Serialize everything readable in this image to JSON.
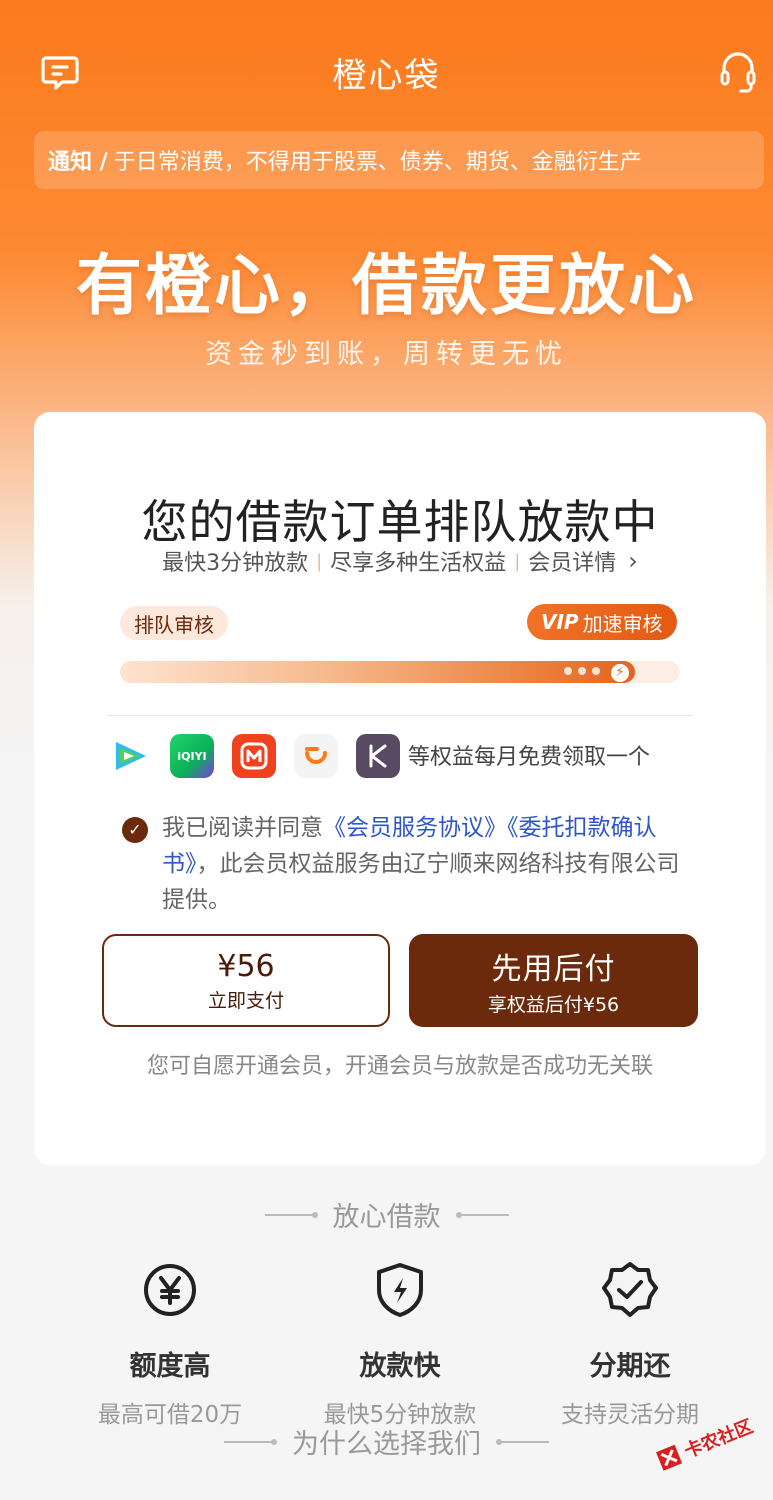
{
  "header": {
    "title": "橙心袋",
    "left_icon": "message-icon",
    "right_icon": "headset-icon"
  },
  "notice": {
    "label": "通知 /",
    "text": "于日常消费，不得用于股票、债券、期货、金融衍生产"
  },
  "hero": {
    "headline": "有橙心，借款更放心",
    "subline": "资金秒到账，周转更无忧"
  },
  "card": {
    "title": "您的借款订单排队放款中",
    "subtitle_items": [
      "最快3分钟放款",
      "尽享多种生活权益",
      "会员详情"
    ],
    "progress": {
      "start_label": "排队审核",
      "vip_badge": "VIP",
      "vip_label": "加速审核",
      "value": 0.92
    },
    "benefits_text": "等权益每月免费领取一个",
    "benefit_icons": [
      "tencent-video-icon",
      "iqiyi-icon",
      "mango-tv-icon",
      "didi-icon",
      "keep-icon"
    ],
    "iqiyi_text": "iQIYI",
    "agreement": {
      "prefix": "我已阅读并同意",
      "link1": "《会员服务协议》",
      "link2": "《委托扣款确认书》",
      "suffix": "，此会员权益服务由辽宁顺来网络科技有限公司提供。"
    },
    "pay_button": {
      "price": "¥56",
      "label": "立即支付"
    },
    "later_button": {
      "label": "先用后付",
      "sub": "享权益后付¥56"
    },
    "disclaimer": "您可自愿开通会员，开通会员与放款是否成功无关联"
  },
  "section1": {
    "title": "放心借款"
  },
  "features": [
    {
      "icon": "yen-circle-icon",
      "name": "额度高",
      "desc": "最高可借20万"
    },
    {
      "icon": "shield-bolt-icon",
      "name": "放款快",
      "desc": "最快5分钟放款"
    },
    {
      "icon": "badge-check-icon",
      "name": "分期还",
      "desc": "支持灵活分期"
    }
  ],
  "section2": {
    "title": "为什么选择我们"
  },
  "watermark": {
    "text": "卡农社区"
  },
  "colors": {
    "brand_orange": "#fc7a1c",
    "brown": "#6b2a0c",
    "link_blue": "#2f56c9"
  }
}
